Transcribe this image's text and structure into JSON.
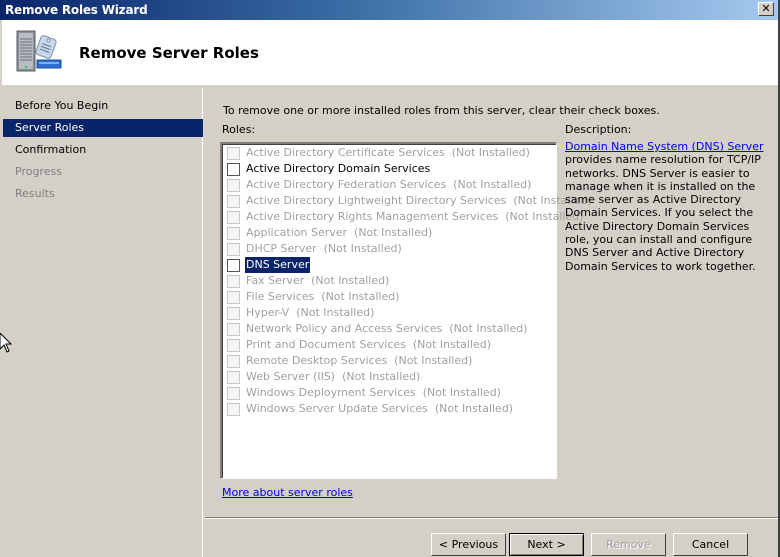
{
  "window": {
    "title": "Remove Roles Wizard",
    "close_glyph": "✕"
  },
  "header": {
    "icon": "server-roles-icon",
    "heading": "Remove Server Roles"
  },
  "sidebar": {
    "items": [
      {
        "label": "Before You Begin",
        "state": "normal"
      },
      {
        "label": "Server Roles",
        "state": "active"
      },
      {
        "label": "Confirmation",
        "state": "normal"
      },
      {
        "label": "Progress",
        "state": "disabled"
      },
      {
        "label": "Results",
        "state": "disabled"
      }
    ]
  },
  "main": {
    "instruction": "To remove one or more installed roles from this server, clear their check boxes.",
    "roles_label": "Roles:",
    "roles": [
      {
        "label": "Active Directory Certificate Services  (Not Installed)",
        "enabled": false,
        "checked": false,
        "selected": false
      },
      {
        "label": "Active Directory Domain Services",
        "enabled": true,
        "checked": false,
        "selected": false
      },
      {
        "label": "Active Directory Federation Services  (Not Installed)",
        "enabled": false,
        "checked": false,
        "selected": false
      },
      {
        "label": "Active Directory Lightweight Directory Services  (Not Installed)",
        "enabled": false,
        "checked": false,
        "selected": false
      },
      {
        "label": "Active Directory Rights Management Services  (Not Installed)",
        "enabled": false,
        "checked": false,
        "selected": false
      },
      {
        "label": "Application Server  (Not Installed)",
        "enabled": false,
        "checked": false,
        "selected": false
      },
      {
        "label": "DHCP Server  (Not Installed)",
        "enabled": false,
        "checked": false,
        "selected": false
      },
      {
        "label": "DNS Server",
        "enabled": true,
        "checked": false,
        "selected": true
      },
      {
        "label": "Fax Server  (Not Installed)",
        "enabled": false,
        "checked": false,
        "selected": false
      },
      {
        "label": "File Services  (Not Installed)",
        "enabled": false,
        "checked": false,
        "selected": false
      },
      {
        "label": "Hyper-V  (Not Installed)",
        "enabled": false,
        "checked": false,
        "selected": false
      },
      {
        "label": "Network Policy and Access Services  (Not Installed)",
        "enabled": false,
        "checked": false,
        "selected": false
      },
      {
        "label": "Print and Document Services  (Not Installed)",
        "enabled": false,
        "checked": false,
        "selected": false
      },
      {
        "label": "Remote Desktop Services  (Not Installed)",
        "enabled": false,
        "checked": false,
        "selected": false
      },
      {
        "label": "Web Server (IIS)  (Not Installed)",
        "enabled": false,
        "checked": false,
        "selected": false
      },
      {
        "label": "Windows Deployment Services  (Not Installed)",
        "enabled": false,
        "checked": false,
        "selected": false
      },
      {
        "label": "Windows Server Update Services  (Not Installed)",
        "enabled": false,
        "checked": false,
        "selected": false
      }
    ],
    "description_label": "Description:",
    "description_link": "Domain Name System (DNS) Server",
    "description_text": " provides name resolution for TCP/IP networks. DNS Server is easier to manage when it is installed on the same server as Active Directory Domain Services. If you select the Active Directory Domain Services role, you can install and configure DNS Server and Active Directory Domain Services to work together.",
    "more_link": "More about server roles"
  },
  "buttons": {
    "previous": "< Previous",
    "next": "Next >",
    "remove": "Remove",
    "cancel": "Cancel"
  },
  "colors": {
    "selection": "#0a246a",
    "link": "#0000ee",
    "disabled_text": "#a0a0a0"
  }
}
